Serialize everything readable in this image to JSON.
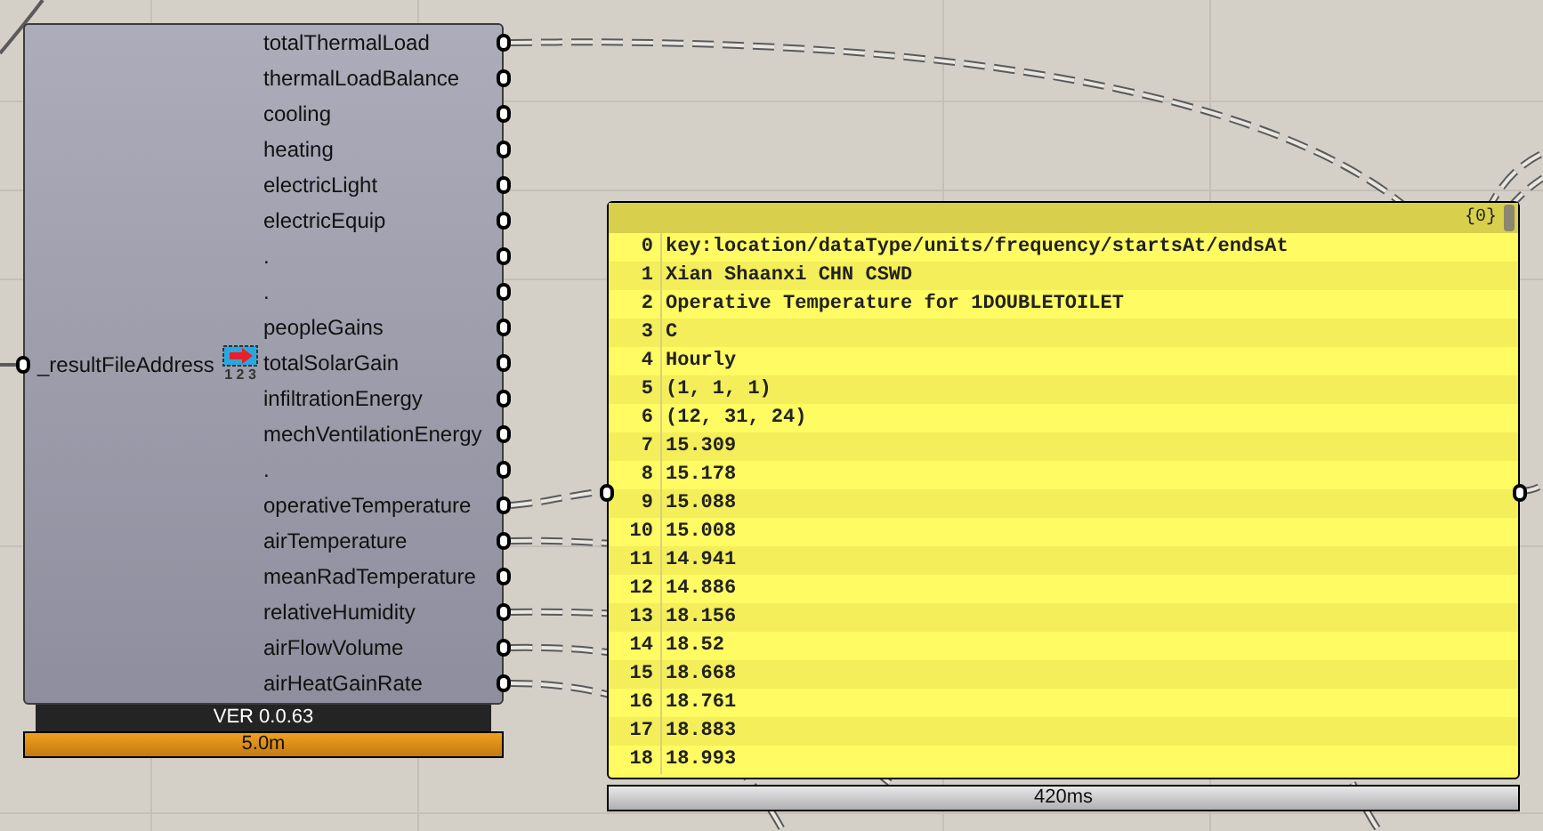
{
  "component": {
    "input": "_resultFileAddress",
    "list_icon_label": "1 2 3",
    "outputs": [
      "totalThermalLoad",
      "thermalLoadBalance",
      "cooling",
      "heating",
      "electricLight",
      "electricEquip",
      ".",
      ".",
      "peopleGains",
      "totalSolarGain",
      "infiltrationEnergy",
      "mechVentilationEnergy",
      ".",
      "operativeTemperature",
      "airTemperature",
      "meanRadTemperature",
      "relativeHumidity",
      "airFlowVolume",
      "airHeatGainRate"
    ],
    "version": "VER 0.0.63",
    "timer": "5.0m"
  },
  "panel": {
    "path": "{0}",
    "rows": [
      {
        "index": "0",
        "value": "key:location/dataType/units/frequency/startsAt/endsAt"
      },
      {
        "index": "1",
        "value": "Xian Shaanxi CHN CSWD"
      },
      {
        "index": "2",
        "value": "Operative Temperature for 1DOUBLETOILET"
      },
      {
        "index": "3",
        "value": "C"
      },
      {
        "index": "4",
        "value": "Hourly"
      },
      {
        "index": "5",
        "value": "(1, 1, 1)"
      },
      {
        "index": "6",
        "value": "(12, 31, 24)"
      },
      {
        "index": "7",
        "value": "15.309"
      },
      {
        "index": "8",
        "value": "15.178"
      },
      {
        "index": "9",
        "value": "15.088"
      },
      {
        "index": "10",
        "value": "15.008"
      },
      {
        "index": "11",
        "value": "14.941"
      },
      {
        "index": "12",
        "value": "14.886"
      },
      {
        "index": "13",
        "value": "18.156"
      },
      {
        "index": "14",
        "value": "18.52"
      },
      {
        "index": "15",
        "value": "18.668"
      },
      {
        "index": "16",
        "value": "18.761"
      },
      {
        "index": "17",
        "value": "18.883"
      },
      {
        "index": "18",
        "value": "18.993"
      }
    ],
    "timer": "420ms"
  }
}
